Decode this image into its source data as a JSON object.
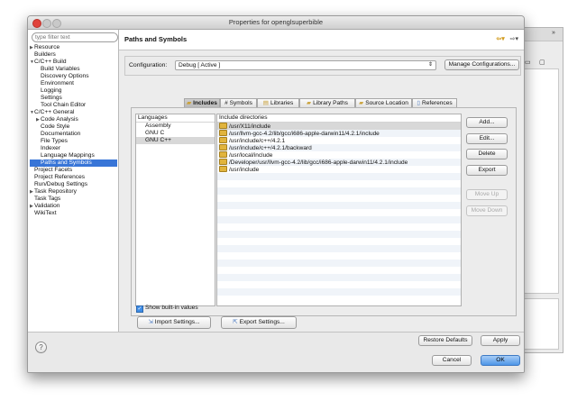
{
  "window": {
    "title": "Properties for openglsuperbible"
  },
  "filter": {
    "placeholder": "type filter text"
  },
  "tree": [
    {
      "label": "Resource",
      "arrow": "▶",
      "level": 0
    },
    {
      "label": "Builders",
      "arrow": "",
      "level": 0
    },
    {
      "label": "C/C++ Build",
      "arrow": "▼",
      "level": 0
    },
    {
      "label": "Build Variables",
      "arrow": "",
      "level": 1
    },
    {
      "label": "Discovery Options",
      "arrow": "",
      "level": 1
    },
    {
      "label": "Environment",
      "arrow": "",
      "level": 1
    },
    {
      "label": "Logging",
      "arrow": "",
      "level": 1
    },
    {
      "label": "Settings",
      "arrow": "",
      "level": 1
    },
    {
      "label": "Tool Chain Editor",
      "arrow": "",
      "level": 1
    },
    {
      "label": "C/C++ General",
      "arrow": "▼",
      "level": 0
    },
    {
      "label": "Code Analysis",
      "arrow": "▶",
      "level": 1
    },
    {
      "label": "Code Style",
      "arrow": "",
      "level": 1
    },
    {
      "label": "Documentation",
      "arrow": "",
      "level": 1
    },
    {
      "label": "File Types",
      "arrow": "",
      "level": 1
    },
    {
      "label": "Indexer",
      "arrow": "",
      "level": 1
    },
    {
      "label": "Language Mappings",
      "arrow": "",
      "level": 1
    },
    {
      "label": "Paths and Symbols",
      "arrow": "",
      "level": 1,
      "selected": true
    },
    {
      "label": "Project Facets",
      "arrow": "",
      "level": 0
    },
    {
      "label": "Project References",
      "arrow": "",
      "level": 0
    },
    {
      "label": "Run/Debug Settings",
      "arrow": "",
      "level": 0
    },
    {
      "label": "Task Repository",
      "arrow": "▶",
      "level": 0
    },
    {
      "label": "Task Tags",
      "arrow": "",
      "level": 0
    },
    {
      "label": "Validation",
      "arrow": "▶",
      "level": 0
    },
    {
      "label": "WikiText",
      "arrow": "",
      "level": 0
    }
  ],
  "page": {
    "title": "Paths and Symbols",
    "nav_back": "⇦▾",
    "nav_fwd": "⇨▾"
  },
  "config": {
    "label": "Configuration:",
    "value": "Debug  [ Active ]",
    "manage": "Manage Configurations..."
  },
  "tabs": [
    {
      "label": "Includes",
      "icon": "folder-icon",
      "active": true
    },
    {
      "label": "# Symbols",
      "icon": "",
      "active": false
    },
    {
      "label": "Libraries",
      "icon": "library-icon",
      "active": false
    },
    {
      "label": "Library Paths",
      "icon": "folder-icon",
      "active": false
    },
    {
      "label": "Source Location",
      "icon": "folder-icon",
      "active": false
    },
    {
      "label": "References",
      "icon": "file-icon",
      "active": false
    }
  ],
  "languages": {
    "header": "Languages",
    "items": [
      "Assembly",
      "GNU C",
      "GNU C++"
    ],
    "selected": 2
  },
  "directories": {
    "header": "Include directories",
    "items": [
      "/usr/X11/include",
      "/usr/llvm-gcc-4.2/lib/gcc/i686-apple-darwin11/4.2.1/include",
      "/usr/include/c++/4.2.1",
      "/usr/include/c++/4.2.1/backward",
      "/usr/local/include",
      "/Developer/usr/llvm-gcc-4.2/lib/gcc/i686-apple-darwin11/4.2.1/include",
      "/usr/include"
    ]
  },
  "side_buttons": {
    "add": "Add...",
    "edit": "Edit...",
    "delete": "Delete",
    "export": "Export",
    "up": "Move Up",
    "down": "Move Down"
  },
  "show_builtin": "Show built-in values",
  "import_btn": "Import Settings...",
  "export_btn": "Export Settings...",
  "restore": "Restore Defaults",
  "apply": "Apply",
  "cancel": "Cancel",
  "ok": "OK",
  "help": "?",
  "colors": {
    "selection": "#3875d7",
    "default_button": "#4e96e8",
    "folder": "#e1b43d"
  }
}
